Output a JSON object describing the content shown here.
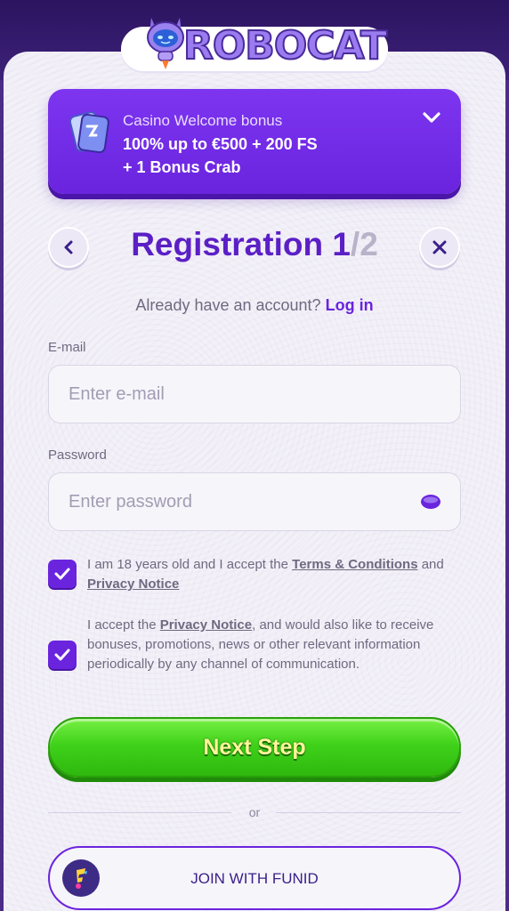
{
  "brand": {
    "logo_text": "ROBOCAT",
    "accent_color": "#6a24de",
    "cta_color": "#3fd21a"
  },
  "bonus": {
    "title": "Casino Welcome bonus",
    "line1": "100% up to €500 + 200 FS",
    "line2": "+ 1 Bonus Crab",
    "icon": "bonus-card-icon",
    "toggle_icon": "chevron-down-icon"
  },
  "header": {
    "title": "Registration",
    "step_current": "1",
    "step_total": "/2",
    "back_icon": "chevron-left-icon",
    "close_icon": "close-icon"
  },
  "login_prompt": {
    "text": "Already have an account?",
    "link": "Log in"
  },
  "form": {
    "email": {
      "label": "E-mail",
      "placeholder": "Enter e-mail",
      "value": ""
    },
    "password": {
      "label": "Password",
      "placeholder": "Enter password",
      "value": "",
      "toggle_icon": "eye-icon"
    }
  },
  "consents": {
    "terms": {
      "checked": true,
      "text_before": "I am 18 years old and I accept the ",
      "link1": "Terms & Conditions",
      "text_mid": " and ",
      "link2": "Privacy Notice"
    },
    "marketing": {
      "checked": true,
      "text_before": "I accept the ",
      "link": "Privacy Notice",
      "text_after": ", and would also like to receive bonuses, promotions, news or other relevant information periodically by any channel of communication."
    }
  },
  "actions": {
    "next_label": "Next Step",
    "divider_text": "or",
    "funid_label": "JOIN WITH FUNID"
  }
}
